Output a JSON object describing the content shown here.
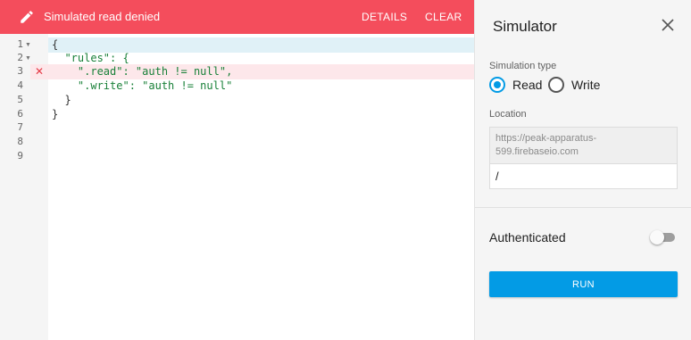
{
  "banner": {
    "message": "Simulated read denied",
    "details_label": "DETAILS",
    "clear_label": "CLEAR",
    "color": "#f44d5c"
  },
  "editor": {
    "line_numbers": [
      "1",
      "2",
      "3",
      "4",
      "5",
      "6",
      "7",
      "8",
      "9"
    ],
    "error_line": "3",
    "lines": [
      "{",
      "  \"rules\": {",
      "    \".read\": \"auth != null\",",
      "    \".write\": \"auth != null\"",
      "  }",
      "}",
      "",
      "",
      ""
    ]
  },
  "simulator": {
    "title": "Simulator",
    "simulation_type_label": "Simulation type",
    "options": [
      "Read",
      "Write"
    ],
    "selected": "Read",
    "location_label": "Location",
    "location_base": "https://peak-apparatus-599.firebaseio.com",
    "location_path": "/",
    "authenticated_label": "Authenticated",
    "authenticated": false,
    "run_label": "RUN",
    "accent": "#039be5"
  }
}
